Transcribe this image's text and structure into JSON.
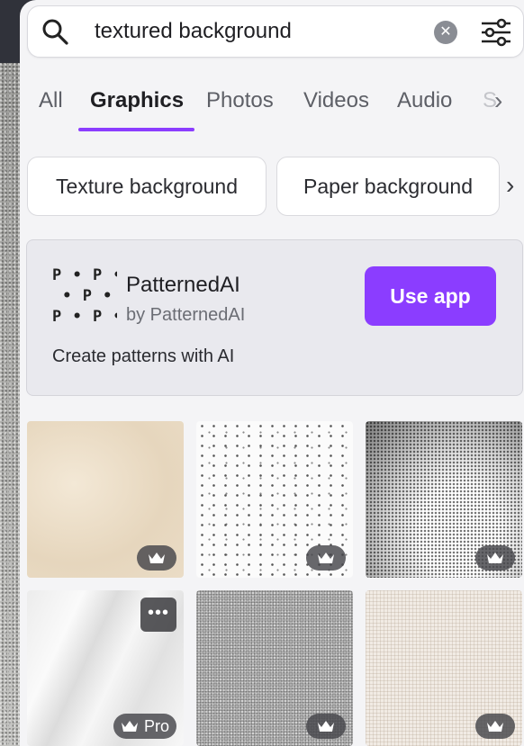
{
  "search": {
    "query": "textured background"
  },
  "tabs": [
    {
      "label": "All"
    },
    {
      "label": "Graphics",
      "active": true
    },
    {
      "label": "Photos"
    },
    {
      "label": "Videos"
    },
    {
      "label": "Audio"
    },
    {
      "label": "S"
    }
  ],
  "suggestions": [
    {
      "label": "Texture background"
    },
    {
      "label": "Paper background"
    }
  ],
  "app": {
    "logo_text": "P • P • P\n • P • P •\nP • P • P",
    "name": "PatternedAI",
    "by": "by PatternedAI",
    "button": "Use app",
    "description": "Create patterns with AI"
  },
  "results": [
    {
      "style": "beige-paper",
      "badge_icon": "crown-icon"
    },
    {
      "style": "white-speckle",
      "badge_icon": "crown-icon"
    },
    {
      "style": "halftone-wave",
      "badge_icon": "crown-icon"
    },
    {
      "style": "crumpled-paper",
      "badge_icon": "crown-icon",
      "badge_label": "Pro",
      "has_more_menu": true
    },
    {
      "style": "grey-noise",
      "badge_icon": "crown-icon"
    },
    {
      "style": "linen",
      "badge_icon": "crown-icon"
    }
  ],
  "colors": {
    "accent": "#8b3dff",
    "panel_bg": "#f4f4f6",
    "badge_bg": "#46464a"
  }
}
